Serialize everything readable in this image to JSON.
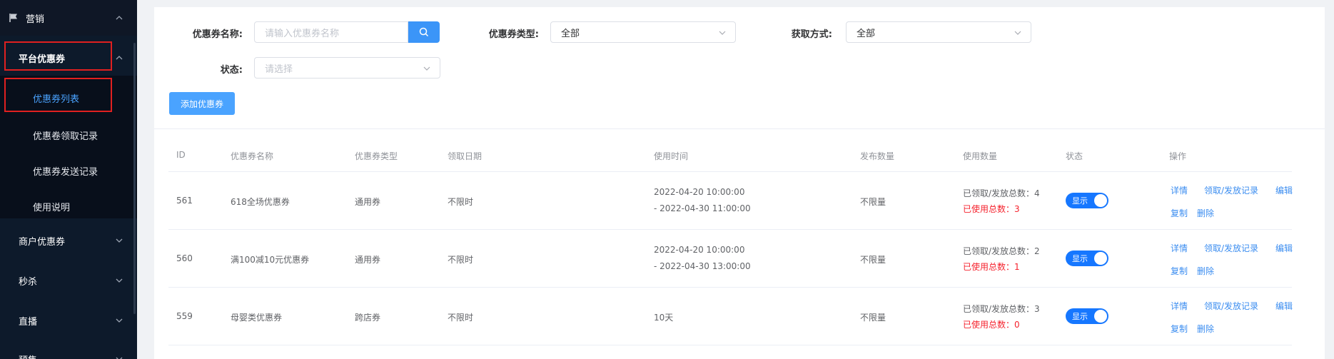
{
  "sidebar": {
    "top_group": "营销",
    "platform_group": "平台优惠券",
    "sub_items": [
      "优惠券列表",
      "优惠卷领取记录",
      "优惠券发送记录",
      "使用说明"
    ],
    "groups": [
      "商户优惠券",
      "秒杀",
      "直播",
      "预售"
    ]
  },
  "filters": {
    "name_label": "优惠券名称:",
    "name_placeholder": "请输入优惠券名称",
    "type_label": "优惠券类型:",
    "type_value": "全部",
    "method_label": "获取方式:",
    "method_value": "全部",
    "status_label": "状态:",
    "status_placeholder": "请选择"
  },
  "add_button": "添加优惠券",
  "table": {
    "headers": [
      "ID",
      "优惠券名称",
      "优惠券类型",
      "领取日期",
      "使用时间",
      "发布数量",
      "使用数量",
      "状态",
      "操作"
    ],
    "rows": [
      {
        "id": "561",
        "name": "618全场优惠券",
        "type": "通用券",
        "date": "不限时",
        "time1": "2022-04-20 10:00:00",
        "time2": "- 2022-04-30 11:00:00",
        "quantity": "不限量",
        "received": "已领取/发放总数：4",
        "used": "已使用总数：3",
        "status": "显示"
      },
      {
        "id": "560",
        "name": "满100减10元优惠券",
        "type": "通用券",
        "date": "不限时",
        "time1": "2022-04-20 10:00:00",
        "time2": "- 2022-04-30 13:00:00",
        "quantity": "不限量",
        "received": "已领取/发放总数：2",
        "used": "已使用总数：1",
        "status": "显示"
      },
      {
        "id": "559",
        "name": "母婴类优惠券",
        "type": "跨店券",
        "date": "不限时",
        "time1": "10天",
        "time2": "",
        "quantity": "不限量",
        "received": "已领取/发放总数：3",
        "used": "已使用总数：0",
        "status": "显示"
      }
    ],
    "actions": [
      "详情",
      "领取/发放记录",
      "编辑",
      "复制",
      "删除"
    ]
  }
}
